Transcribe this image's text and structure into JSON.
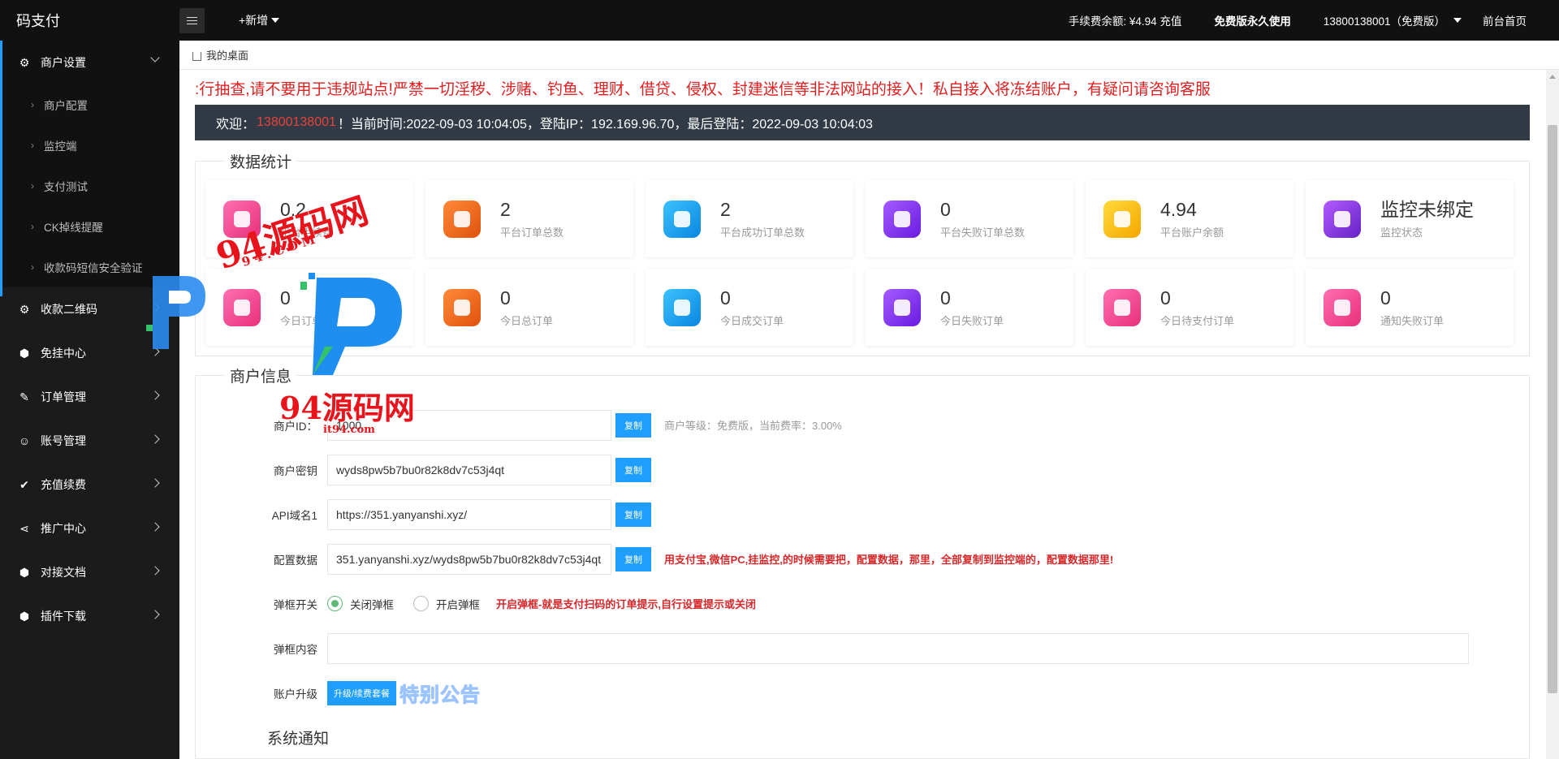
{
  "app": {
    "logo": "码支付"
  },
  "topbar": {
    "add_new": "+新增",
    "balance": "手续费余额: ¥4.94 充值",
    "plan": "免费版永久使用",
    "account": "13800138001（免费版）",
    "front_home": "前台首页"
  },
  "sidebar": {
    "groups": [
      {
        "label": "商户设置",
        "icon": "gear-icon",
        "expanded": true
      },
      {
        "label": "收款二维码",
        "icon": "gear-icon"
      },
      {
        "label": "免挂中心",
        "icon": "cube-icon"
      },
      {
        "label": "订单管理",
        "icon": "edit-icon"
      },
      {
        "label": "账号管理",
        "icon": "user-icon"
      },
      {
        "label": "充值续费",
        "icon": "check-icon"
      },
      {
        "label": "推广中心",
        "icon": "share-icon"
      },
      {
        "label": "对接文档",
        "icon": "cube-icon"
      },
      {
        "label": "插件下载",
        "icon": "cube-icon"
      }
    ],
    "sub_items": [
      "商户配置",
      "监控端",
      "支付测试",
      "CK掉线提醒",
      "收款码短信安全验证"
    ]
  },
  "breadcrumb": {
    "label": "我的桌面"
  },
  "notice": ":行抽查,请不要用于违规站点!严禁一切淫秽、涉赌、钓鱼、理财、借贷、侵权、封建迷信等非法网站的接入！私自接入将冻结账户，有疑问请咨询客服",
  "welcome": {
    "prefix": "欢迎：",
    "user": "13800138001",
    "rest": "！当前时间:2022-09-03 10:04:05，登陆IP：192.169.96.70，最后登陆：2022-09-03 10:04:03"
  },
  "stats": {
    "title": "数据统计",
    "cards": [
      {
        "value": "0.2",
        "label": "平台手续费",
        "color": "pink"
      },
      {
        "value": "2",
        "label": "平台订单总数",
        "color": "orange"
      },
      {
        "value": "2",
        "label": "平台成功订单总数",
        "color": "blue"
      },
      {
        "value": "0",
        "label": "平台失败订单总数",
        "color": "purple"
      },
      {
        "value": "4.94",
        "label": "平台账户余额",
        "color": "yellow"
      },
      {
        "value": "监控未绑定",
        "label": "监控状态",
        "color": "violet"
      },
      {
        "value": "0",
        "label": "今日订单金额",
        "color": "pink"
      },
      {
        "value": "0",
        "label": "今日总订单",
        "color": "orange"
      },
      {
        "value": "0",
        "label": "今日成交订单",
        "color": "blue"
      },
      {
        "value": "0",
        "label": "今日失败订单",
        "color": "purple"
      },
      {
        "value": "0",
        "label": "今日待支付订单",
        "color": "pink"
      },
      {
        "value": "0",
        "label": "通知失败订单",
        "color": "pink"
      }
    ]
  },
  "merchant": {
    "title": "商户信息",
    "copy_label": "复制",
    "id_label": "商户ID：",
    "id_value": "1000",
    "level_hint": "商户等级：免费版，当前费率：3.00%",
    "key_label": "商户密钥",
    "key_value": "wyds8pw5b7bu0r82k8dv7c53j4qt",
    "api_label": "API域名1",
    "api_value": "https://351.yanyanshi.xyz/",
    "config_label": "配置数据",
    "config_value": "351.yanyanshi.xyz/wyds8pw5b7bu0r82k8dv7c53j4qt",
    "config_hint": "用支付宝,微信PC,挂监控,的时候需要把，配置数据，那里，全部复制到监控端的，配置数据那里!",
    "popup_label": "弹框开关",
    "popup_off": "关闭弹框",
    "popup_on": "开启弹框",
    "popup_hint": "开启弹框-就是支付扫码的订单提示,自行设置提示或关闭",
    "popup_content_label": "弹框内容",
    "popup_content_value": "",
    "upgrade_label": "账户升级",
    "upgrade_button": "升级/续费套餐",
    "special": "特别公告"
  },
  "system_notice": "系统通知",
  "watermark": {
    "text1": "94源码网",
    "text2": "9 4 . C O M",
    "text3": "94源码网",
    "text4": "it94.com"
  }
}
